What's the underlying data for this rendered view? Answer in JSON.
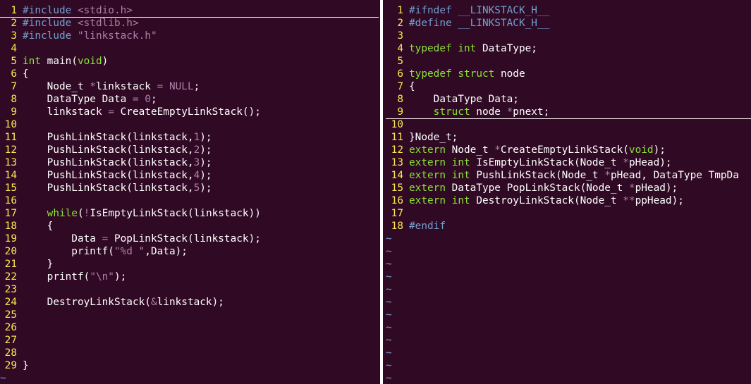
{
  "colors": {
    "background": "#300a24",
    "line_number": "#fce94f",
    "preprocessor": "#729fcf",
    "keyword": "#8ae234",
    "string": "#ad7fa8",
    "text": "#ffffff"
  },
  "left": {
    "lines": [
      {
        "n": "1",
        "tokens": [
          {
            "c": "pp",
            "t": "#include "
          },
          {
            "c": "str",
            "t": "<stdio.h>"
          }
        ]
      },
      {
        "n": "2",
        "tokens": [
          {
            "c": "pp",
            "t": "#include "
          },
          {
            "c": "str",
            "t": "<stdlib.h>"
          }
        ]
      },
      {
        "n": "3",
        "tokens": [
          {
            "c": "pp",
            "t": "#include "
          },
          {
            "c": "str",
            "t": "\"linkstack.h\""
          }
        ]
      },
      {
        "n": "4",
        "tokens": []
      },
      {
        "n": "5",
        "tokens": [
          {
            "c": "kw",
            "t": "int"
          },
          {
            "c": "",
            "t": " main("
          },
          {
            "c": "kw",
            "t": "void"
          },
          {
            "c": "",
            "t": ")"
          }
        ]
      },
      {
        "n": "6",
        "tokens": [
          {
            "c": "",
            "t": "{"
          }
        ]
      },
      {
        "n": "7",
        "tokens": [
          {
            "c": "",
            "t": "    Node_t "
          },
          {
            "c": "op",
            "t": "*"
          },
          {
            "c": "",
            "t": "linkstack "
          },
          {
            "c": "op",
            "t": "="
          },
          {
            "c": "",
            "t": " "
          },
          {
            "c": "str",
            "t": "NULL"
          },
          {
            "c": "",
            "t": ";"
          }
        ]
      },
      {
        "n": "8",
        "tokens": [
          {
            "c": "",
            "t": "    DataType Data "
          },
          {
            "c": "op",
            "t": "="
          },
          {
            "c": "",
            "t": " "
          },
          {
            "c": "str",
            "t": "0"
          },
          {
            "c": "",
            "t": ";"
          }
        ]
      },
      {
        "n": "9",
        "tokens": [
          {
            "c": "",
            "t": "    linkstack "
          },
          {
            "c": "op",
            "t": "="
          },
          {
            "c": "",
            "t": " CreateEmptyLinkStack();"
          }
        ]
      },
      {
        "n": "10",
        "tokens": []
      },
      {
        "n": "11",
        "tokens": [
          {
            "c": "",
            "t": "    PushLinkStack(linkstack,"
          },
          {
            "c": "str",
            "t": "1"
          },
          {
            "c": "",
            "t": ");"
          }
        ]
      },
      {
        "n": "12",
        "tokens": [
          {
            "c": "",
            "t": "    PushLinkStack(linkstack,"
          },
          {
            "c": "str",
            "t": "2"
          },
          {
            "c": "",
            "t": ");"
          }
        ]
      },
      {
        "n": "13",
        "tokens": [
          {
            "c": "",
            "t": "    PushLinkStack(linkstack,"
          },
          {
            "c": "str",
            "t": "3"
          },
          {
            "c": "",
            "t": ");"
          }
        ]
      },
      {
        "n": "14",
        "tokens": [
          {
            "c": "",
            "t": "    PushLinkStack(linkstack,"
          },
          {
            "c": "str",
            "t": "4"
          },
          {
            "c": "",
            "t": ");"
          }
        ]
      },
      {
        "n": "15",
        "tokens": [
          {
            "c": "",
            "t": "    PushLinkStack(linkstack,"
          },
          {
            "c": "str",
            "t": "5"
          },
          {
            "c": "",
            "t": ");"
          }
        ]
      },
      {
        "n": "16",
        "tokens": []
      },
      {
        "n": "17",
        "tokens": [
          {
            "c": "",
            "t": "    "
          },
          {
            "c": "kw",
            "t": "while"
          },
          {
            "c": "",
            "t": "("
          },
          {
            "c": "op",
            "t": "!"
          },
          {
            "c": "",
            "t": "IsEmptyLinkStack(linkstack))"
          }
        ]
      },
      {
        "n": "18",
        "tokens": [
          {
            "c": "",
            "t": "    {"
          }
        ]
      },
      {
        "n": "19",
        "tokens": [
          {
            "c": "",
            "t": "        Data "
          },
          {
            "c": "op",
            "t": "="
          },
          {
            "c": "",
            "t": " PopLinkStack(linkstack);"
          }
        ]
      },
      {
        "n": "20",
        "tokens": [
          {
            "c": "",
            "t": "        printf("
          },
          {
            "c": "str",
            "t": "\"%d \""
          },
          {
            "c": "",
            "t": ",Data);"
          }
        ]
      },
      {
        "n": "21",
        "tokens": [
          {
            "c": "",
            "t": "    }"
          }
        ]
      },
      {
        "n": "22",
        "tokens": [
          {
            "c": "",
            "t": "    printf("
          },
          {
            "c": "str",
            "t": "\"\\n\""
          },
          {
            "c": "",
            "t": ");"
          }
        ]
      },
      {
        "n": "23",
        "tokens": []
      },
      {
        "n": "24",
        "tokens": [
          {
            "c": "",
            "t": "    DestroyLinkStack("
          },
          {
            "c": "op",
            "t": "&"
          },
          {
            "c": "",
            "t": "linkstack);"
          }
        ]
      },
      {
        "n": "25",
        "tokens": []
      },
      {
        "n": "26",
        "tokens": []
      },
      {
        "n": "27",
        "tokens": []
      },
      {
        "n": "28",
        "tokens": []
      },
      {
        "n": "29",
        "tokens": [
          {
            "c": "",
            "t": "}"
          }
        ]
      }
    ],
    "tilde": "~"
  },
  "right": {
    "lines": [
      {
        "n": "1",
        "tokens": [
          {
            "c": "pp",
            "t": "#ifndef __LINKSTACK_H__"
          }
        ]
      },
      {
        "n": "2",
        "tokens": [
          {
            "c": "pp",
            "t": "#define __LINKSTACK_H__"
          }
        ]
      },
      {
        "n": "3",
        "tokens": []
      },
      {
        "n": "4",
        "tokens": [
          {
            "c": "kw",
            "t": "typedef"
          },
          {
            "c": "",
            "t": " "
          },
          {
            "c": "kw",
            "t": "int"
          },
          {
            "c": "",
            "t": " DataType;"
          }
        ]
      },
      {
        "n": "5",
        "tokens": []
      },
      {
        "n": "6",
        "tokens": [
          {
            "c": "kw",
            "t": "typedef"
          },
          {
            "c": "",
            "t": " "
          },
          {
            "c": "kw",
            "t": "struct"
          },
          {
            "c": "",
            "t": " node"
          }
        ]
      },
      {
        "n": "7",
        "tokens": [
          {
            "c": "",
            "t": "{"
          }
        ]
      },
      {
        "n": "8",
        "tokens": [
          {
            "c": "",
            "t": "    DataType Data;"
          }
        ]
      },
      {
        "n": "9",
        "tokens": [
          {
            "c": "",
            "t": "    "
          },
          {
            "c": "kw",
            "t": "struct"
          },
          {
            "c": "",
            "t": " node "
          },
          {
            "c": "op",
            "t": "*"
          },
          {
            "c": "",
            "t": "pnext;"
          }
        ]
      },
      {
        "n": "10",
        "tokens": []
      },
      {
        "n": "11",
        "tokens": [
          {
            "c": "",
            "t": "}Node_t;"
          }
        ]
      },
      {
        "n": "12",
        "tokens": [
          {
            "c": "kw",
            "t": "extern"
          },
          {
            "c": "",
            "t": " Node_t "
          },
          {
            "c": "op",
            "t": "*"
          },
          {
            "c": "",
            "t": "CreateEmptyLinkStack("
          },
          {
            "c": "kw",
            "t": "void"
          },
          {
            "c": "",
            "t": ");"
          }
        ]
      },
      {
        "n": "13",
        "tokens": [
          {
            "c": "kw",
            "t": "extern"
          },
          {
            "c": "",
            "t": " "
          },
          {
            "c": "kw",
            "t": "int"
          },
          {
            "c": "",
            "t": " IsEmptyLinkStack(Node_t "
          },
          {
            "c": "op",
            "t": "*"
          },
          {
            "c": "",
            "t": "pHead);"
          }
        ]
      },
      {
        "n": "14",
        "tokens": [
          {
            "c": "kw",
            "t": "extern"
          },
          {
            "c": "",
            "t": " "
          },
          {
            "c": "kw",
            "t": "int"
          },
          {
            "c": "",
            "t": " PushLinkStack(Node_t "
          },
          {
            "c": "op",
            "t": "*"
          },
          {
            "c": "",
            "t": "pHead, DataType TmpDa"
          }
        ]
      },
      {
        "n": "15",
        "tokens": [
          {
            "c": "kw",
            "t": "extern"
          },
          {
            "c": "",
            "t": " DataType PopLinkStack(Node_t "
          },
          {
            "c": "op",
            "t": "*"
          },
          {
            "c": "",
            "t": "pHead);"
          }
        ]
      },
      {
        "n": "16",
        "tokens": [
          {
            "c": "kw",
            "t": "extern"
          },
          {
            "c": "",
            "t": " "
          },
          {
            "c": "kw",
            "t": "int"
          },
          {
            "c": "",
            "t": " DestroyLinkStack(Node_t "
          },
          {
            "c": "op",
            "t": "**"
          },
          {
            "c": "",
            "t": "ppHead);"
          }
        ]
      },
      {
        "n": "17",
        "tokens": []
      },
      {
        "n": "18",
        "tokens": [
          {
            "c": "pp",
            "t": "#endif"
          }
        ]
      }
    ],
    "tilde": "~"
  }
}
